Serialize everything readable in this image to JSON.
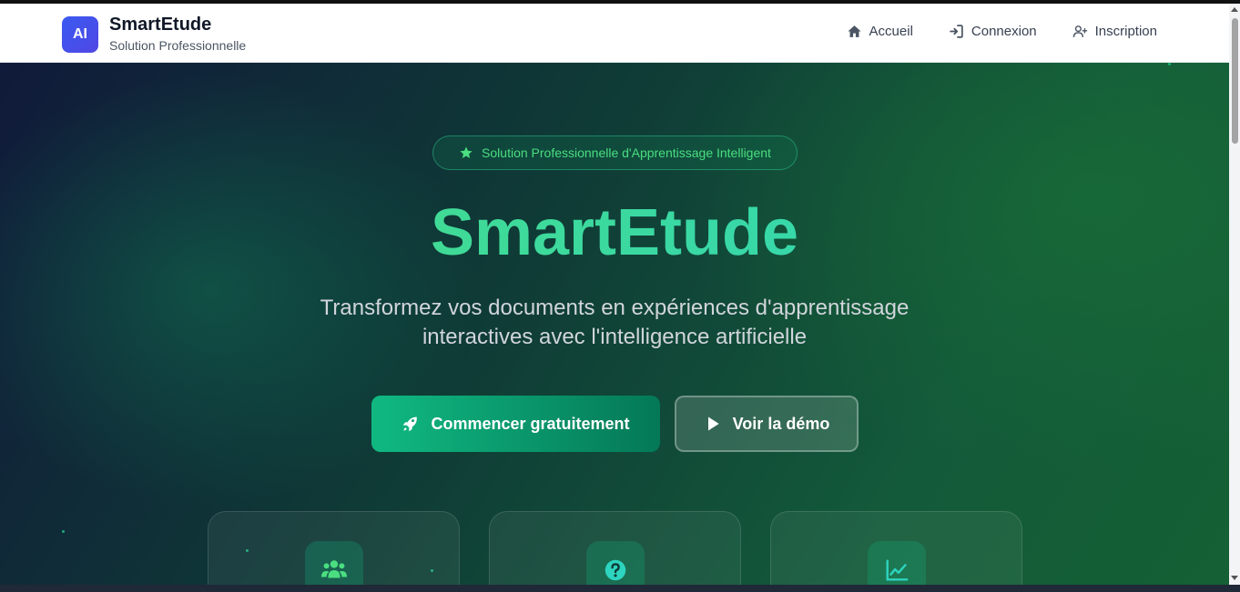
{
  "brand": {
    "logo_text": "AI",
    "name": "SmartEtude",
    "subtitle": "Solution Professionnelle"
  },
  "nav": [
    {
      "label": "Accueil",
      "icon": "home-icon"
    },
    {
      "label": "Connexion",
      "icon": "login-icon"
    },
    {
      "label": "Inscription",
      "icon": "user-plus-icon"
    }
  ],
  "hero": {
    "badge": "Solution Professionnelle d'Apprentissage Intelligent",
    "badge_icon": "star-icon",
    "title": "SmartEtude",
    "subtitle": "Transformez vos documents en expériences d'apprentissage interactives avec l'intelligence artificielle",
    "primary_button": "Commencer gratuitement",
    "primary_icon": "rocket-icon",
    "secondary_button": "Voir la démo",
    "secondary_icon": "play-icon"
  },
  "feature_cards": [
    {
      "icon": "users-icon"
    },
    {
      "icon": "question-circle-icon"
    },
    {
      "icon": "chart-line-icon"
    }
  ],
  "colors": {
    "accent_green": "#4ade80",
    "accent_teal": "#2dd4bf",
    "primary_button": "#10b981",
    "logo_blue": "#3b5bf0"
  }
}
